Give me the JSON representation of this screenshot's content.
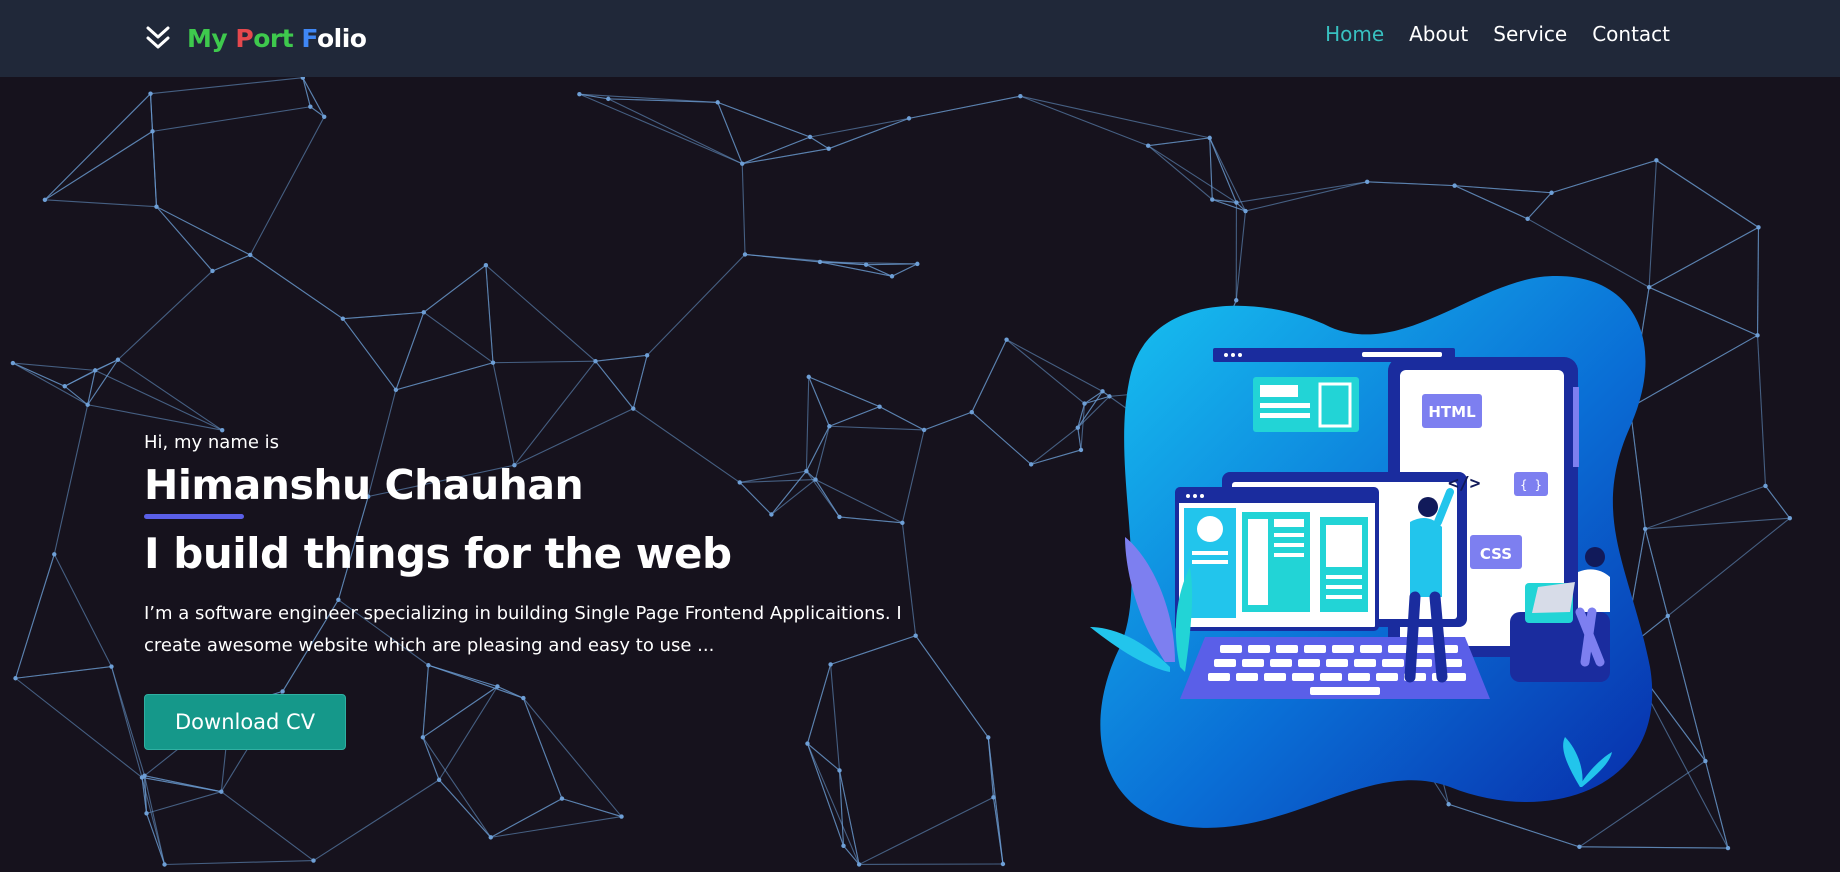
{
  "brand": {
    "letters": [
      {
        "char": "M",
        "color": "#3ec94d"
      },
      {
        "char": "y",
        "color": "#3ec94d"
      },
      {
        "char": " ",
        "color": "#ffffff"
      },
      {
        "char": "P",
        "color": "#e5484d"
      },
      {
        "char": "ort ",
        "color": "#3ec94d"
      },
      {
        "char": "F",
        "color": "#3f87f5"
      },
      {
        "char": "olio",
        "color": "#ffffff"
      }
    ],
    "icon": "double-chevron-down-icon"
  },
  "nav": {
    "items": [
      {
        "label": "Home",
        "active": true
      },
      {
        "label": "About",
        "active": false
      },
      {
        "label": "Service",
        "active": false
      },
      {
        "label": "Contact",
        "active": false
      }
    ]
  },
  "hero": {
    "greeting": "Hi, my name is",
    "name": "Himanshu Chauhan",
    "tagline": "I build things for the web",
    "description": "I’m a software engineer specializing in building Single Page Frontend Applicaitions. I create awesome website which are pleasing and easy to use ...",
    "download_label": "Download CV"
  },
  "illustration": {
    "html_label": "HTML",
    "css_label": "CSS",
    "braces_label": "{ }",
    "code_label": "</>"
  },
  "colors": {
    "background": "#16121d",
    "navbar": "#202839",
    "accent": "#38c0c0",
    "button": "#15988a",
    "underline": "#5a5fe8",
    "network_line": "#6e9fd6"
  }
}
